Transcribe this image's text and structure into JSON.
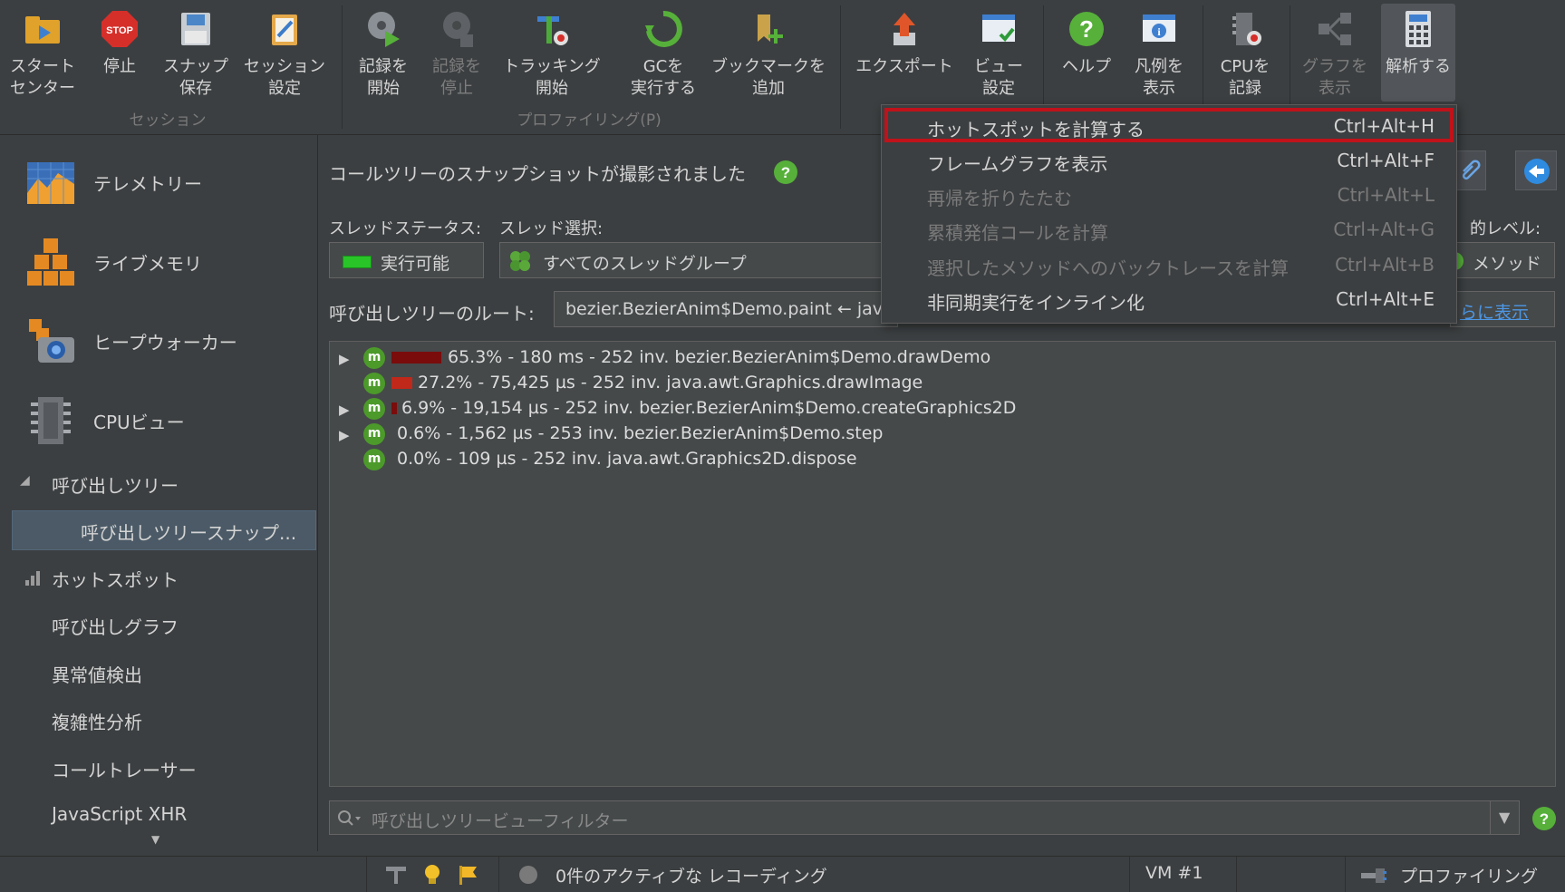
{
  "toolbar": {
    "buttons": [
      {
        "label": "スタート\nセンター",
        "icon": "folder-play-icon"
      },
      {
        "label": "停止",
        "icon": "stop-sign-icon"
      },
      {
        "label": "スナップ\n保存",
        "icon": "save-snapshot-icon"
      },
      {
        "label": "セッション\n設定",
        "icon": "session-settings-icon"
      },
      {
        "label": "記録を\n開始",
        "icon": "start-recording-icon"
      },
      {
        "label": "記録を\n停止",
        "icon": "stop-recording-icon"
      },
      {
        "label": "トラッキング\n開始",
        "icon": "start-tracking-icon"
      },
      {
        "label": "GCを\n実行する",
        "icon": "run-gc-icon"
      },
      {
        "label": "ブックマークを\n追加",
        "icon": "add-bookmark-icon"
      },
      {
        "label": "エクスポート",
        "icon": "export-icon"
      },
      {
        "label": "ビュー\n設定",
        "icon": "view-settings-icon"
      },
      {
        "label": "ヘルプ",
        "icon": "help-icon"
      },
      {
        "label": "凡例を\n表示",
        "icon": "show-legend-icon"
      },
      {
        "label": "CPUを\n記録",
        "icon": "record-cpu-icon"
      },
      {
        "label": "グラフを\n表示",
        "icon": "show-graph-icon"
      },
      {
        "label": "解析する",
        "icon": "calculator-icon"
      }
    ],
    "groups": {
      "session": "セッション",
      "profiling": "プロファイリング(P)"
    }
  },
  "sidebar": {
    "big_items": [
      {
        "label": "テレメトリー",
        "icon": "telemetry-icon"
      },
      {
        "label": "ライブメモリ",
        "icon": "live-memory-icon"
      },
      {
        "label": "ヒープウォーカー",
        "icon": "heap-walker-icon"
      },
      {
        "label": "CPUビュー",
        "icon": "cpu-view-icon"
      }
    ],
    "call_tree_section": "呼び出しツリー",
    "selected_item": "呼び出しツリースナップ...",
    "items": [
      "ホットスポット",
      "呼び出しグラフ",
      "異常値検出",
      "複雑性分析",
      "コールトレーサー",
      "JavaScript XHR"
    ]
  },
  "main": {
    "title": "コールツリーのスナップショットが撮影されました",
    "thread_status_label": "スレッドステータス:",
    "thread_select_label": "スレッド選択:",
    "thread_status_value": "実行可能",
    "thread_select_value": "すべてのスレッドグループ",
    "aggregation_label_partial": "的レベル:",
    "aggregation_value": "メソッド",
    "root_label": "呼び出しツリーのルート:",
    "root_value": "bezier.BezierAnim$Demo.paint ← java",
    "more_link": "らに表示",
    "filter_placeholder": "呼び出しツリービューフィルター"
  },
  "tree_rows": [
    {
      "text": "65.3% - 180 ms - 252 inv. bezier.BezierAnim$Demo.drawDemo",
      "percent": 65.3,
      "expandable": true
    },
    {
      "text": "27.2% - 75,425 µs - 252 inv. java.awt.Graphics.drawImage",
      "percent": 27.2,
      "expandable": false
    },
    {
      "text": "6.9% - 19,154 µs - 252 inv. bezier.BezierAnim$Demo.createGraphics2D",
      "percent": 6.9,
      "expandable": true
    },
    {
      "text": "0.6% - 1,562 µs - 253 inv. bezier.BezierAnim$Demo.step",
      "percent": 0.6,
      "expandable": true
    },
    {
      "text": "0.0% - 109 µs - 252 inv. java.awt.Graphics2D.dispose",
      "percent": 0.0,
      "expandable": false
    }
  ],
  "menu": {
    "items": [
      {
        "label": "ホットスポットを計算する",
        "shortcut": "Ctrl+Alt+H",
        "enabled": true
      },
      {
        "label": "フレームグラフを表示",
        "shortcut": "Ctrl+Alt+F",
        "enabled": true
      },
      {
        "label": "再帰を折りたたむ",
        "shortcut": "Ctrl+Alt+L",
        "enabled": false
      },
      {
        "label": "累積発信コールを計算",
        "shortcut": "Ctrl+Alt+G",
        "enabled": false
      },
      {
        "label": "選択したメソッドへのバックトレースを計算",
        "shortcut": "Ctrl+Alt+B",
        "enabled": false
      },
      {
        "label": "非同期実行をインライン化",
        "shortcut": "Ctrl+Alt+E",
        "enabled": true
      }
    ]
  },
  "status": {
    "recordings": "0件のアクティブな レコーディング",
    "vm": "VM #1",
    "mode": "プロファイリング"
  },
  "colors": {
    "background": "#3c3f41",
    "panel": "#45494a",
    "highlight": "#c0121a",
    "bar_dark": "#7a0c0c",
    "bar_red": "#c0281a",
    "method_green": "#4c9a2a"
  }
}
